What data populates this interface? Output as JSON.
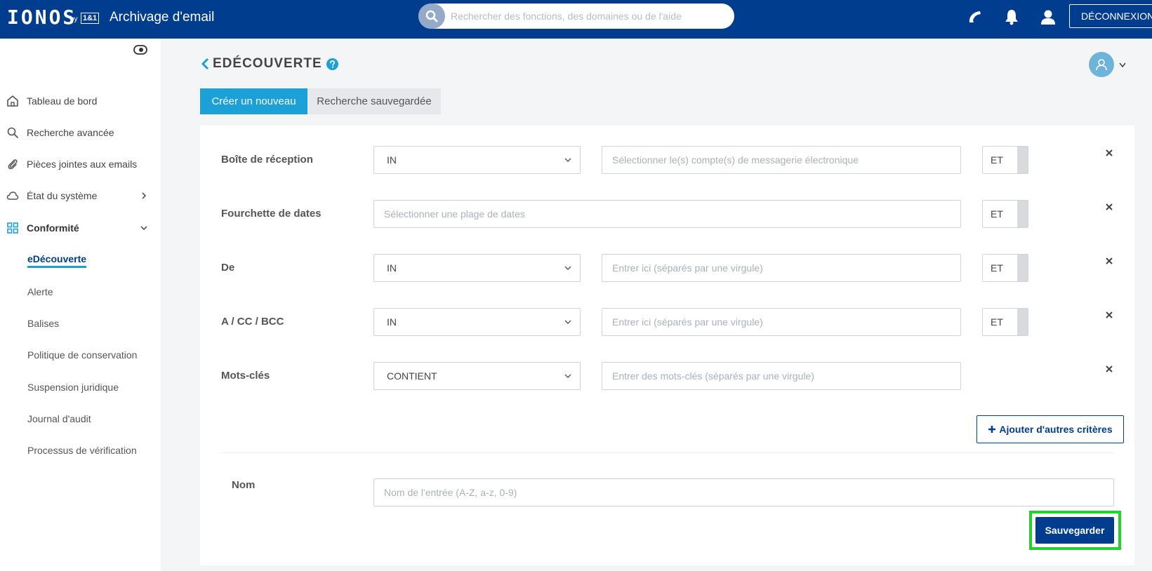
{
  "topbar": {
    "logo_text": "IONOS",
    "logo_by": "by",
    "logo_partner": "1&1",
    "app_title": "Archivage d'email",
    "search_placeholder": "Rechercher des fonctions, des domaines ou de l'aide",
    "logout_label": "DÉCONNEXION"
  },
  "sidebar": {
    "items": [
      {
        "label": "Tableau de bord",
        "icon": "home-icon"
      },
      {
        "label": "Recherche avancée",
        "icon": "search-icon"
      },
      {
        "label": "Pièces jointes aux emails",
        "icon": "paperclip-icon"
      },
      {
        "label": "État du système",
        "icon": "cloud-icon"
      },
      {
        "label": "Conformité",
        "icon": "grid-icon"
      }
    ],
    "sub_items": [
      "eDécouverte",
      "Alerte",
      "Balises",
      "Politique de conservation",
      "Suspension juridique",
      "Journal d'audit",
      "Processus de vérification"
    ]
  },
  "main": {
    "page_title": "EDÉCOUVERTE",
    "tabs": [
      {
        "label": "Créer un nouveau",
        "active": true
      },
      {
        "label": "Recherche sauvegardée",
        "active": false
      }
    ],
    "criteria": [
      {
        "label": "Boîte de réception",
        "operator": "IN",
        "placeholder": "Sélectionner le(s) compte(s) de messagerie électronique",
        "conjunction": "ET"
      },
      {
        "label": "Fourchette de dates",
        "placeholder": "Sélectionner une plage de dates",
        "conjunction": "ET"
      },
      {
        "label": "De",
        "operator": "IN",
        "placeholder": "Entrer ici (séparés par une virgule)",
        "conjunction": "ET"
      },
      {
        "label": "A / CC / BCC",
        "operator": "IN",
        "placeholder": "Entrer ici (séparés par une virgule)",
        "conjunction": "ET"
      },
      {
        "label": "Mots-clés",
        "operator": "CONTIENT",
        "placeholder": "Entrer des mots-clés (séparés par une virgule)"
      }
    ],
    "add_criteria_label": "Ajouter d'autres critères",
    "name_label": "Nom",
    "name_placeholder": "Nom de l'entrée (A-Z, a-z, 0-9)",
    "save_label": "Sauvegarder"
  },
  "colors": {
    "topbar": "#003d8f",
    "accent": "#1ba0d8",
    "highlight": "#1fd42d"
  }
}
